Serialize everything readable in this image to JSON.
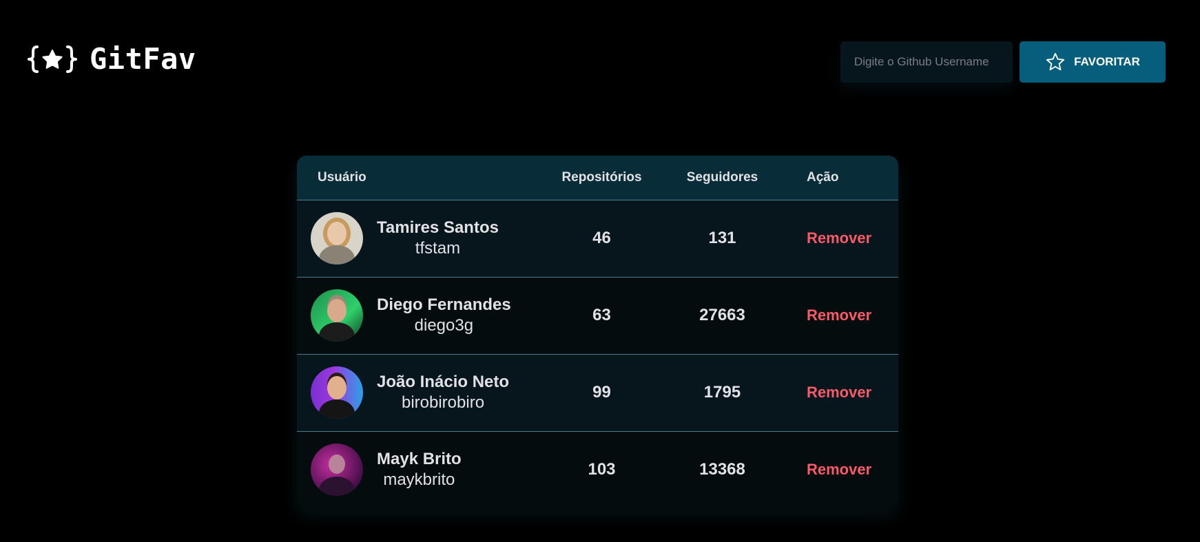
{
  "header": {
    "logo_text": "GitFav",
    "search_placeholder": "Digite o Github Username",
    "favorite_label": "FAVORITAR"
  },
  "table": {
    "columns": {
      "user": "Usuário",
      "repos": "Repositórios",
      "followers": "Seguidores",
      "action": "Ação"
    },
    "rows": [
      {
        "name": "Tamires Santos",
        "login": "tfstam",
        "repos": "46",
        "followers": "131",
        "action": "Remover"
      },
      {
        "name": "Diego Fernandes",
        "login": "diego3g",
        "repos": "63",
        "followers": "27663",
        "action": "Remover"
      },
      {
        "name": "João Inácio Neto",
        "login": "birobirobiro",
        "repos": "99",
        "followers": "1795",
        "action": "Remover"
      },
      {
        "name": "Mayk Brito",
        "login": "maykbrito",
        "repos": "103",
        "followers": "13368",
        "action": "Remover"
      }
    ]
  },
  "colors": {
    "background": "#000000",
    "header_row": "#092d38",
    "row_odd": "#06161c",
    "row_even": "#050c0e",
    "button": "#065e7c",
    "remove": "#f75a68"
  }
}
